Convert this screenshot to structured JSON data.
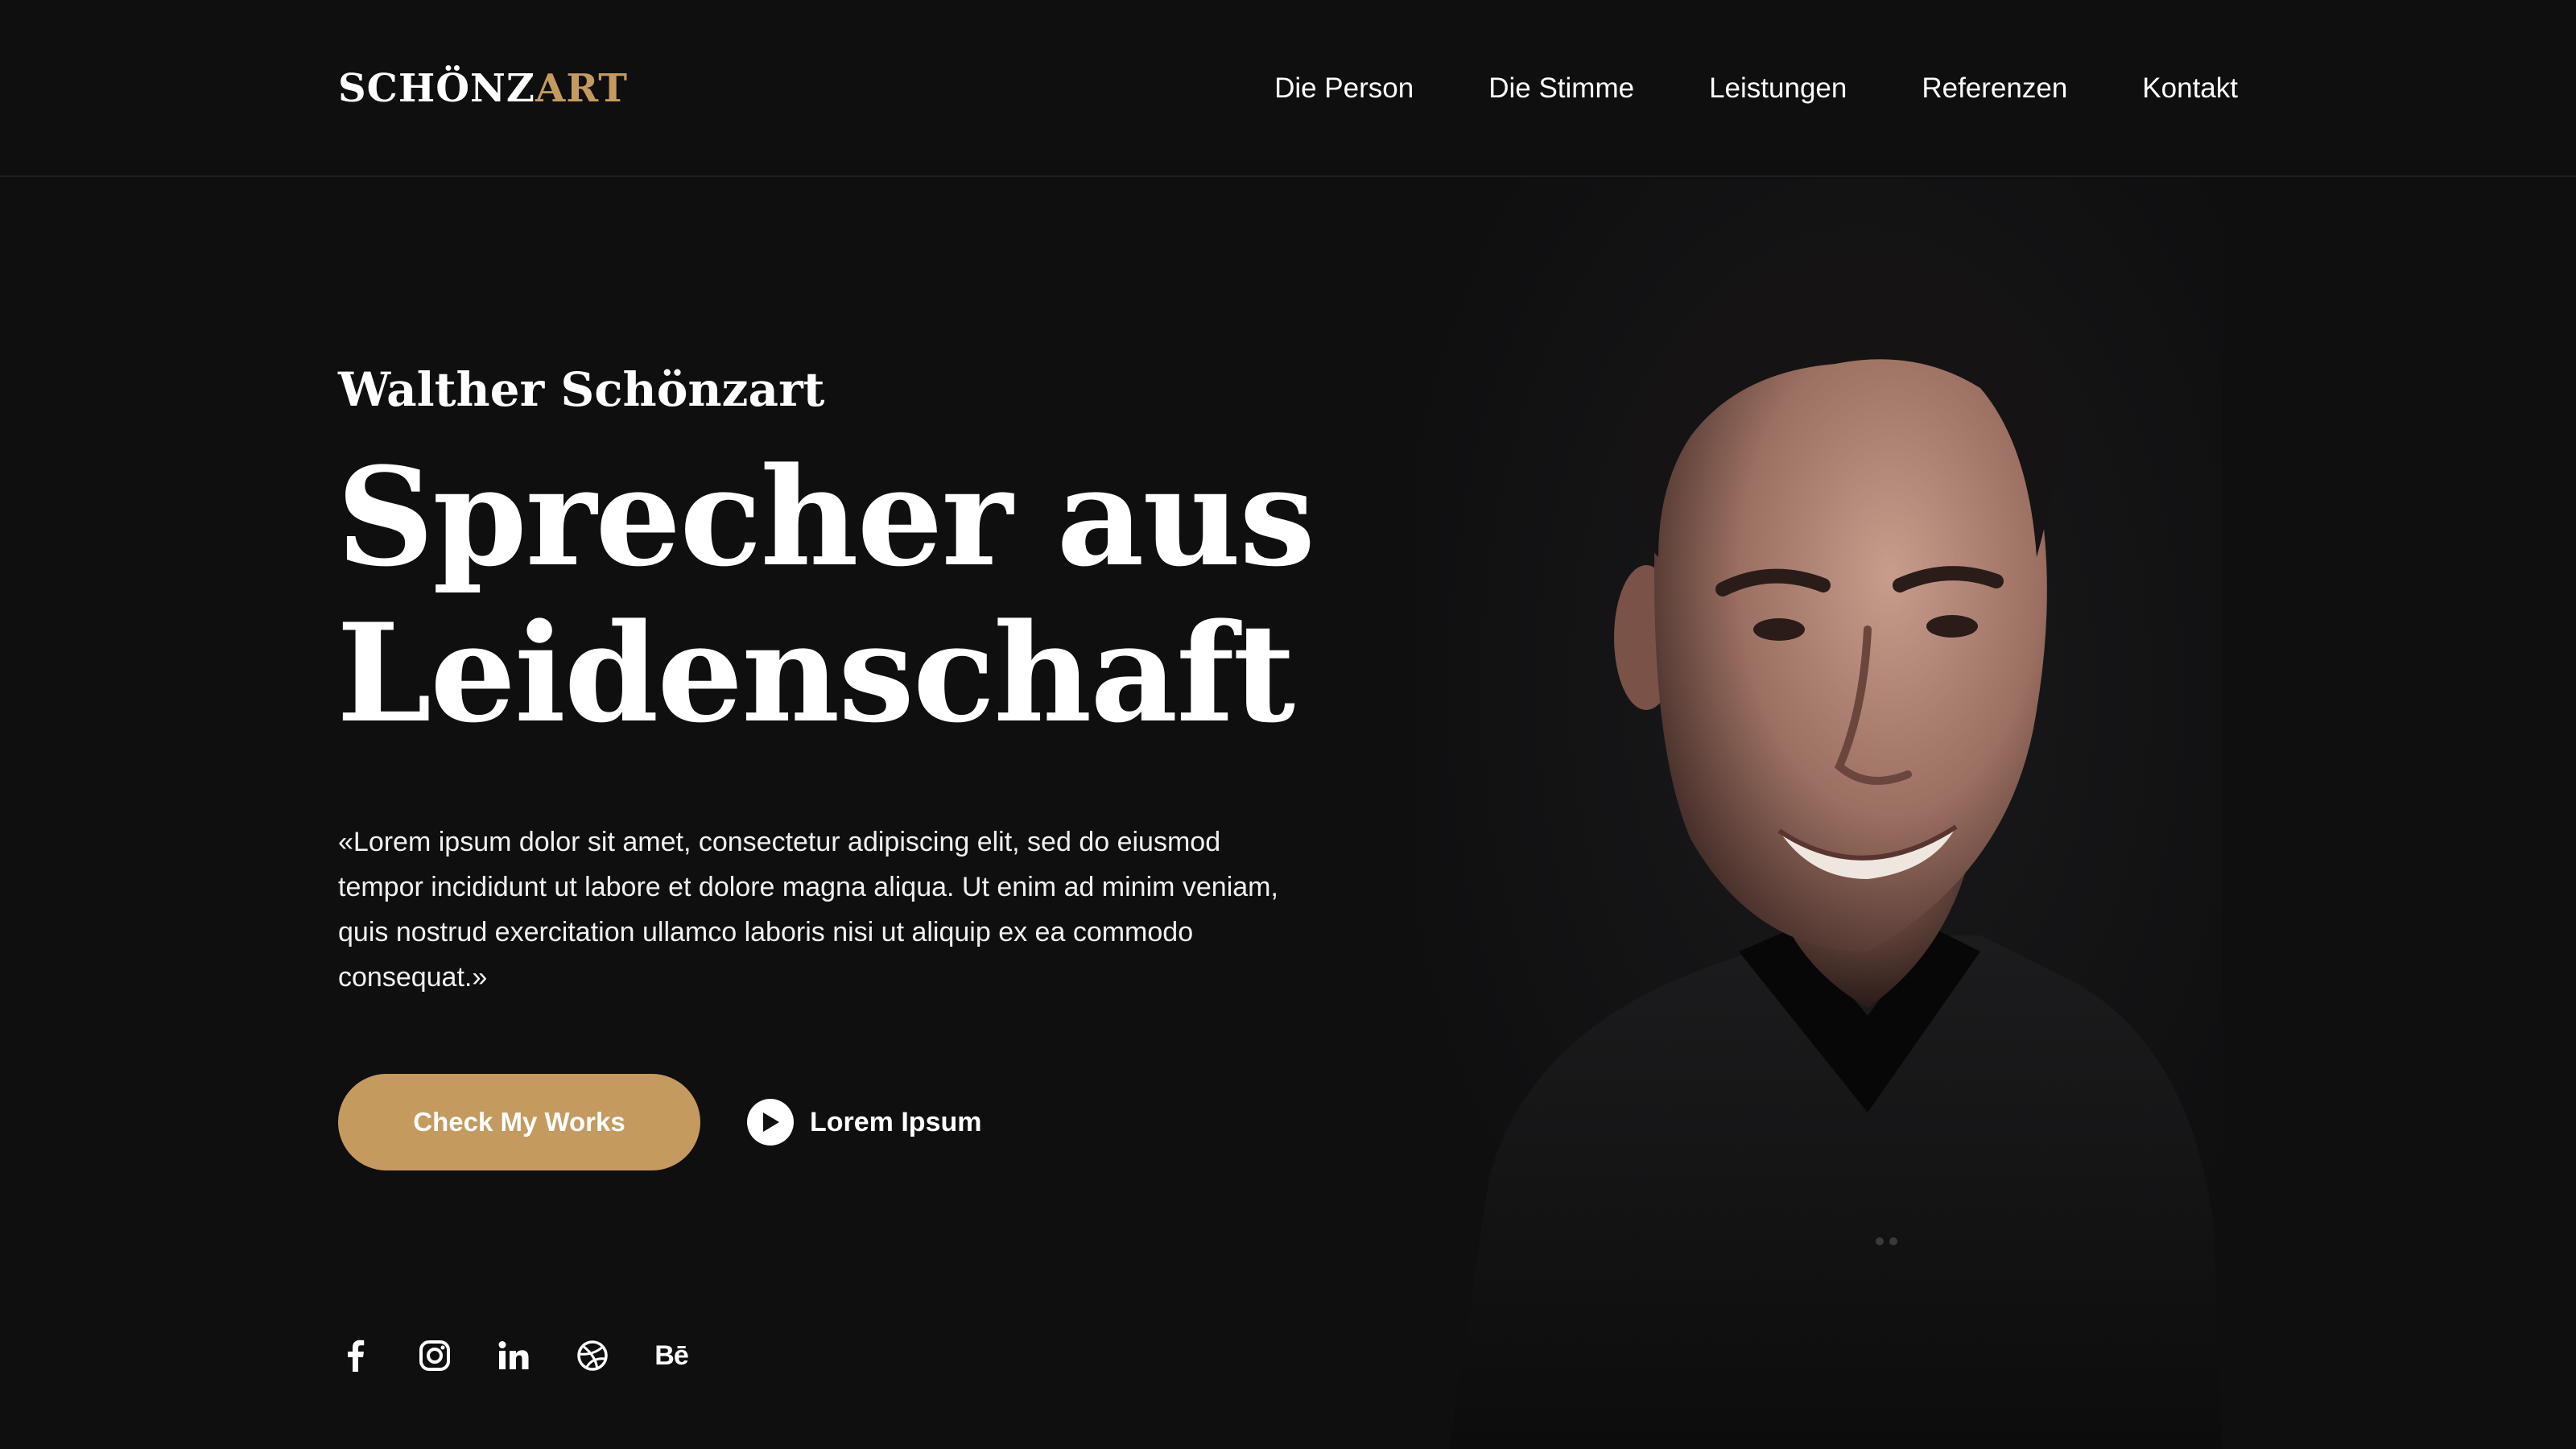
{
  "brand": {
    "logo_main": "SCHÖNZ",
    "logo_accent": "ART",
    "accent_color": "#c49a5e"
  },
  "nav": {
    "items": [
      {
        "label": "Die Person"
      },
      {
        "label": "Die Stimme"
      },
      {
        "label": "Leistungen"
      },
      {
        "label": "Referenzen"
      },
      {
        "label": "Kontakt"
      }
    ]
  },
  "hero": {
    "name": "Walther Schönzart",
    "headline_line1": "Sprecher aus",
    "headline_line2": "Leidenschaft",
    "quote": "«Lorem ipsum dolor sit amet, consectetur adipiscing elit, sed do eiusmod tempor incididunt ut labore et dolore magna aliqua. Ut enim ad minim veniam, quis nostrud exercitation ullamco laboris nisi ut aliquip ex ea commodo consequat.»",
    "cta_label": "Check My Works",
    "play_label": "Lorem Ipsum"
  },
  "social": {
    "icons": [
      "facebook-icon",
      "instagram-icon",
      "linkedin-icon",
      "dribbble-icon",
      "behance-icon"
    ],
    "behance_glyph": "Bē"
  },
  "colors": {
    "background": "#0f0f10",
    "text": "#ffffff"
  }
}
